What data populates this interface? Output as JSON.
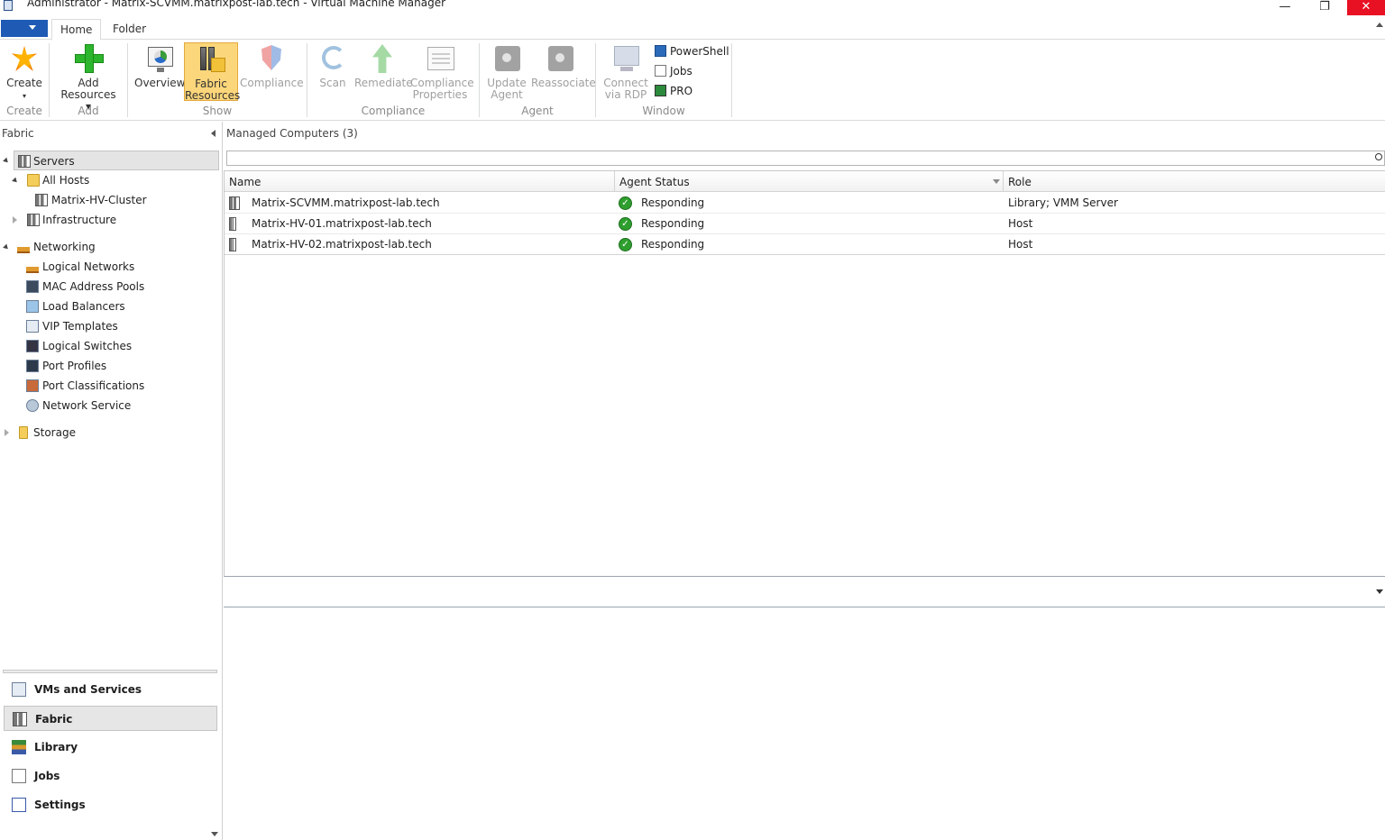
{
  "window": {
    "title": "Administrator - Matrix-SCVMM.matrixpost-lab.tech - Virtual Machine Manager",
    "minimize": "—",
    "restore": "❐",
    "close": "✕"
  },
  "ribbon": {
    "tabs": [
      "Home",
      "Folder"
    ],
    "active_tab": "Home",
    "buttons": {
      "create": "Create",
      "add_resources_1": "Add",
      "add_resources_2": "Resources ▾",
      "overview": "Overview",
      "fabric_resources_1": "Fabric",
      "fabric_resources_2": "Resources",
      "compliance": "Compliance",
      "scan": "Scan",
      "remediate": "Remediate",
      "compliance_properties_1": "Compliance",
      "compliance_properties_2": "Properties",
      "update_agent_1": "Update",
      "update_agent_2": "Agent",
      "reassociate": "Reassociate",
      "connect_rdp_1": "Connect",
      "connect_rdp_2": "via RDP",
      "powershell": "PowerShell",
      "jobs": "Jobs",
      "pro": "PRO"
    },
    "groups": {
      "create": "Create",
      "add": "Add",
      "show": "Show",
      "compliance": "Compliance",
      "agent": "Agent",
      "window": "Window"
    }
  },
  "sidebar": {
    "header": "Fabric",
    "tree": {
      "servers": "Servers",
      "all_hosts": "All Hosts",
      "cluster": "Matrix-HV-Cluster",
      "infrastructure": "Infrastructure",
      "networking": "Networking",
      "logical_networks": "Logical Networks",
      "mac_pools": "MAC Address Pools",
      "load_balancers": "Load Balancers",
      "vip_templates": "VIP Templates",
      "logical_switches": "Logical Switches",
      "port_profiles": "Port Profiles",
      "port_classifications": "Port Classifications",
      "network_service": "Network Service",
      "storage": "Storage"
    },
    "workspaces": [
      "VMs and Services",
      "Fabric",
      "Library",
      "Jobs",
      "Settings"
    ],
    "active_workspace": "Fabric"
  },
  "main": {
    "title": "Managed Computers (3)",
    "search_value": "",
    "columns": [
      "Name",
      "Agent Status",
      "Role"
    ],
    "rows": [
      {
        "name": "Matrix-SCVMM.matrixpost-lab.tech",
        "status": "Responding",
        "role": "Library; VMM Server"
      },
      {
        "name": "Matrix-HV-01.matrixpost-lab.tech",
        "status": "Responding",
        "role": "Host"
      },
      {
        "name": "Matrix-HV-02.matrixpost-lab.tech",
        "status": "Responding",
        "role": "Host"
      }
    ]
  },
  "colors": {
    "active_button": "#fcd67a",
    "file_menu": "#1f5bb5",
    "status_ok": "#2e9f2e",
    "close_button": "#e81123"
  }
}
